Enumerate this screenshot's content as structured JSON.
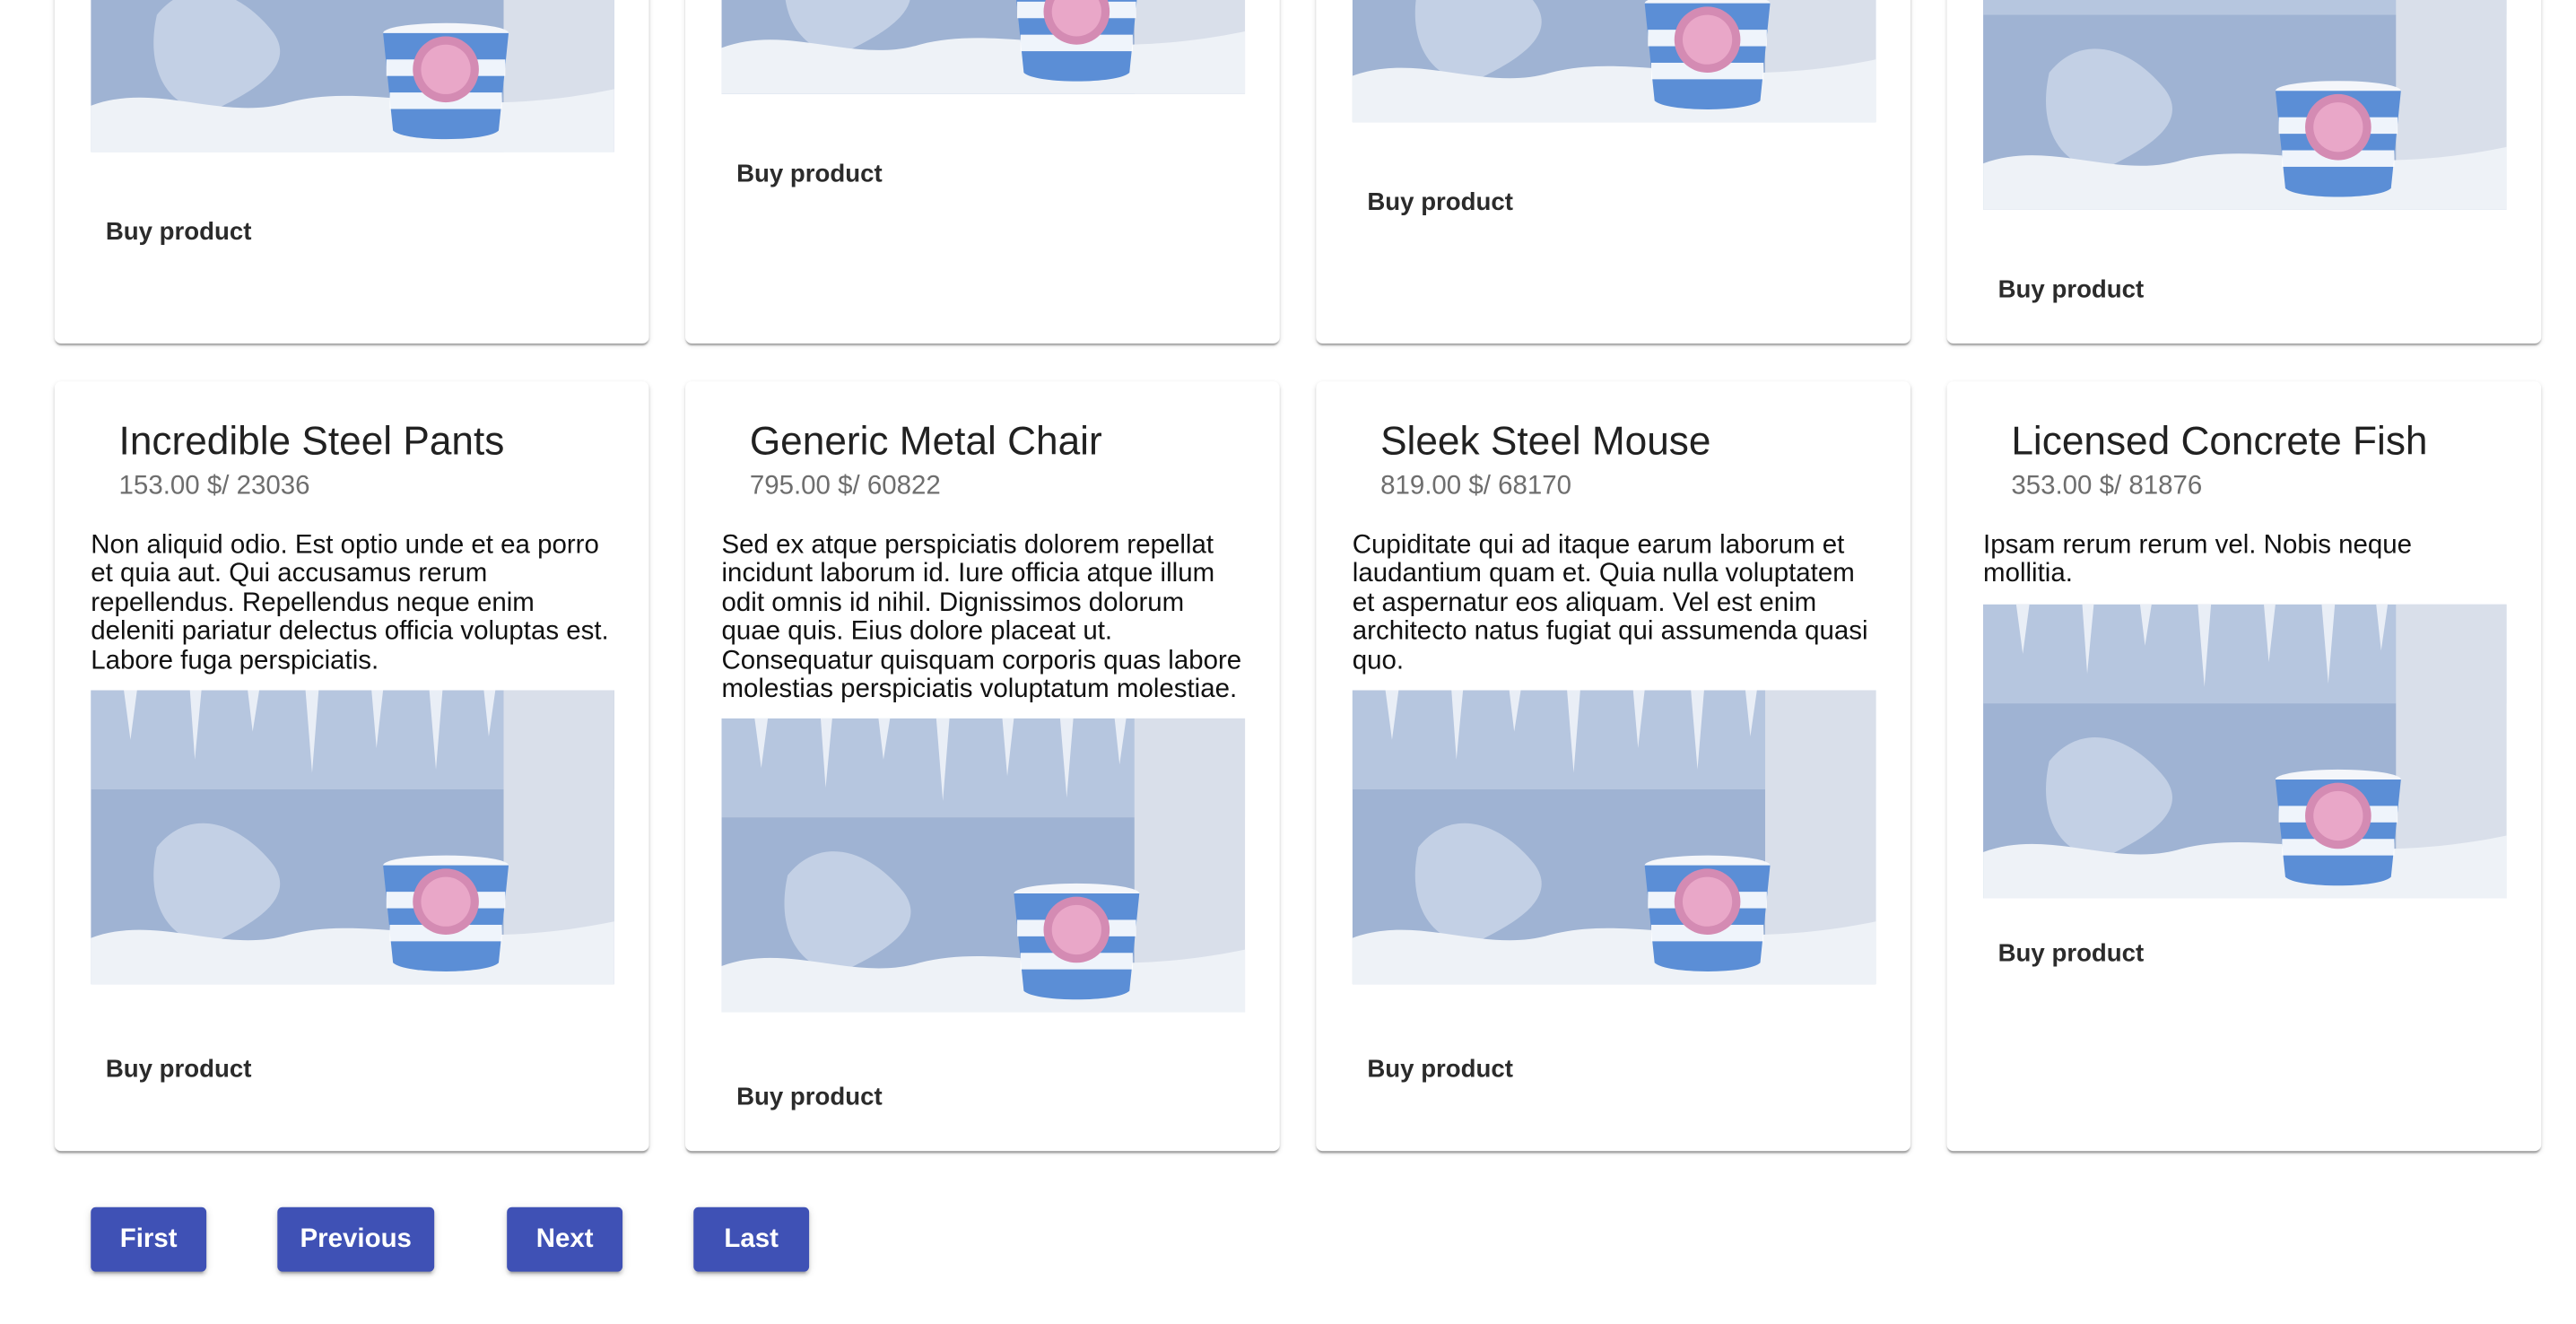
{
  "buy_label": "Buy product",
  "image_alt": "Strawberry ice cream tub in a frosted freezer",
  "products": [
    {
      "title": "Incredible Steel Pants",
      "subtitle": "153.00 $/ 23036",
      "description": "Non aliquid odio. Est optio unde et ea porro et quia aut. Qui accusamus rerum repellendus. Repellendus neque enim deleniti pariatur delectus officia voluptas est. Labore fuga perspiciatis."
    },
    {
      "title": "Generic Metal Chair",
      "subtitle": "795.00 $/ 60822",
      "description": "Sed ex atque perspiciatis dolorem repellat incidunt laborum id. Iure officia atque illum odit omnis id nihil. Dignissimos dolorum quae quis. Eius dolore placeat ut. Consequatur quisquam corporis quas labore molestias perspiciatis voluptatum molestiae."
    },
    {
      "title": "Sleek Steel Mouse",
      "subtitle": "819.00 $/ 68170",
      "description": "Cupiditate qui ad itaque earum laborum et laudantium quam et. Quia nulla voluptatem et aspernatur eos aliquam. Vel est enim architecto natus fugiat qui assumenda quasi quo."
    },
    {
      "title": "Licensed Concrete Fish",
      "subtitle": "353.00 $/ 81876",
      "description": "Ipsam rerum rerum vel. Nobis neque mollitia."
    }
  ],
  "pagination": {
    "first": "First",
    "previous": "Previous",
    "next": "Next",
    "last": "Last"
  },
  "colors": {
    "primary": "#3f51b5"
  }
}
